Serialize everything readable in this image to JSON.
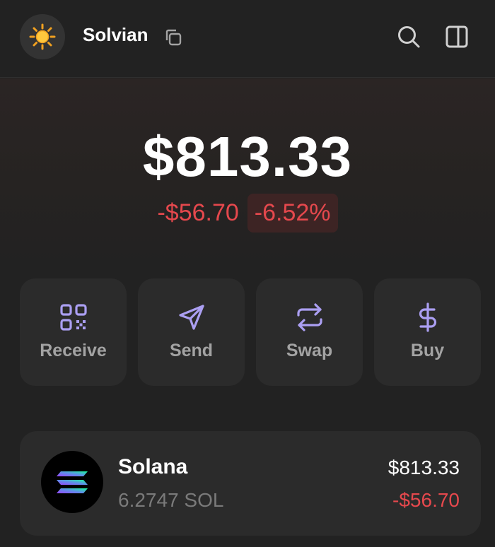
{
  "header": {
    "avatar_icon": "sun-icon",
    "wallet_name": "Solvian",
    "copy_icon": "copy-icon",
    "search_icon": "search-icon",
    "sidebar_icon": "sidebar-panel-icon"
  },
  "portfolio": {
    "balance": "$813.33",
    "change_usd": "-$56.70",
    "change_pct": "-6.52%"
  },
  "actions": [
    {
      "label": "Receive",
      "icon": "qr-code-icon"
    },
    {
      "label": "Send",
      "icon": "send-icon"
    },
    {
      "label": "Swap",
      "icon": "swap-arrows-icon"
    },
    {
      "label": "Buy",
      "icon": "dollar-icon"
    }
  ],
  "tokens": [
    {
      "name": "Solana",
      "amount": "6.2747 SOL",
      "value": "$813.33",
      "change": "-$56.70",
      "icon": "solana-logo-icon"
    }
  ],
  "colors": {
    "background": "#222222",
    "card": "#2b2b2b",
    "accent_purple": "#ab9ff2",
    "negative_red": "#e5484d"
  }
}
